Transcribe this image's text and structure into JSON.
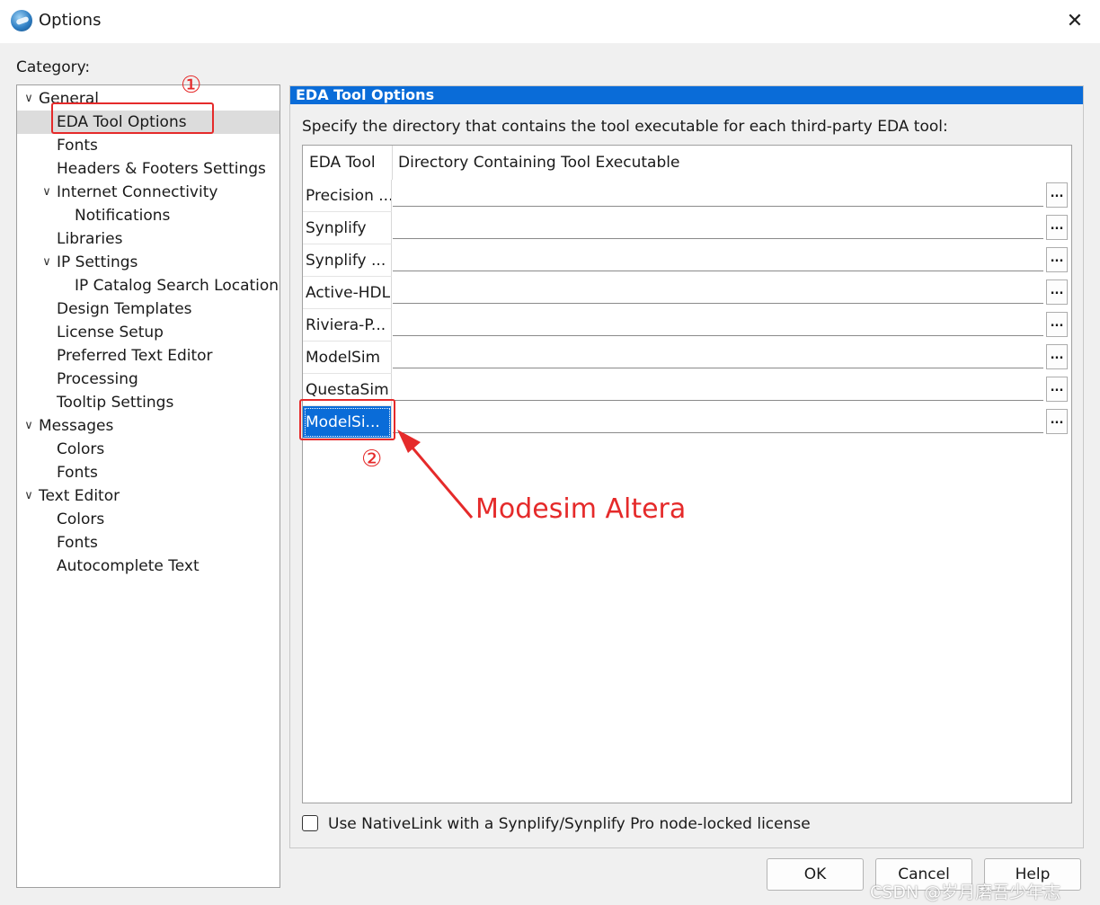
{
  "window": {
    "title": "Options",
    "close_glyph": "✕",
    "icon": "app-icon"
  },
  "category": {
    "label": "Category:",
    "tree": [
      {
        "label": "General",
        "level": 0,
        "expanded": true
      },
      {
        "label": "EDA Tool Options",
        "level": 1,
        "selected": true
      },
      {
        "label": "Fonts",
        "level": 1
      },
      {
        "label": "Headers & Footers Settings",
        "level": 1
      },
      {
        "label": "Internet Connectivity",
        "level": 1,
        "expanded": true
      },
      {
        "label": "Notifications",
        "level": 2
      },
      {
        "label": "Libraries",
        "level": 1
      },
      {
        "label": "IP Settings",
        "level": 1,
        "expanded": true
      },
      {
        "label": "IP Catalog Search Locations",
        "level": 2
      },
      {
        "label": "Design Templates",
        "level": 1
      },
      {
        "label": "License Setup",
        "level": 1
      },
      {
        "label": "Preferred Text Editor",
        "level": 1
      },
      {
        "label": "Processing",
        "level": 1
      },
      {
        "label": "Tooltip Settings",
        "level": 1
      },
      {
        "label": "Messages",
        "level": 0,
        "expanded": true
      },
      {
        "label": "Colors",
        "level": 1
      },
      {
        "label": "Fonts",
        "level": 1
      },
      {
        "label": "Text Editor",
        "level": 0,
        "expanded": true
      },
      {
        "label": "Colors",
        "level": 1
      },
      {
        "label": "Fonts",
        "level": 1
      },
      {
        "label": "Autocomplete Text",
        "level": 1
      }
    ]
  },
  "panel": {
    "header": "EDA Tool Options",
    "instruction": "Specify the directory that contains the tool executable for each third-party EDA tool:",
    "columns": [
      "EDA Tool",
      "Directory Containing Tool Executable"
    ],
    "rows": [
      {
        "tool": "Precision ...",
        "path": ""
      },
      {
        "tool": "Synplify",
        "path": ""
      },
      {
        "tool": "Synplify ...",
        "path": ""
      },
      {
        "tool": "Active-HDL",
        "path": ""
      },
      {
        "tool": "Riviera-P...",
        "path": ""
      },
      {
        "tool": "ModelSim",
        "path": ""
      },
      {
        "tool": "QuestaSim",
        "path": ""
      },
      {
        "tool": "ModelSi...",
        "path": "",
        "selected": true
      }
    ],
    "browse_label": "...",
    "nativelink_checkbox": {
      "label": "Use NativeLink with a Synplify/Synplify Pro node-locked license",
      "checked": false
    }
  },
  "buttons": {
    "ok": "OK",
    "cancel": "Cancel",
    "help": "Help"
  },
  "annotations": {
    "step1": "①",
    "step2": "②",
    "note": "Modesim Altera",
    "color": "#e52a2a"
  },
  "watermark": "CSDN @岁月磨吾少年志",
  "colors": {
    "accent": "#0a6cd8",
    "selection_gray": "#dcdcdc"
  }
}
